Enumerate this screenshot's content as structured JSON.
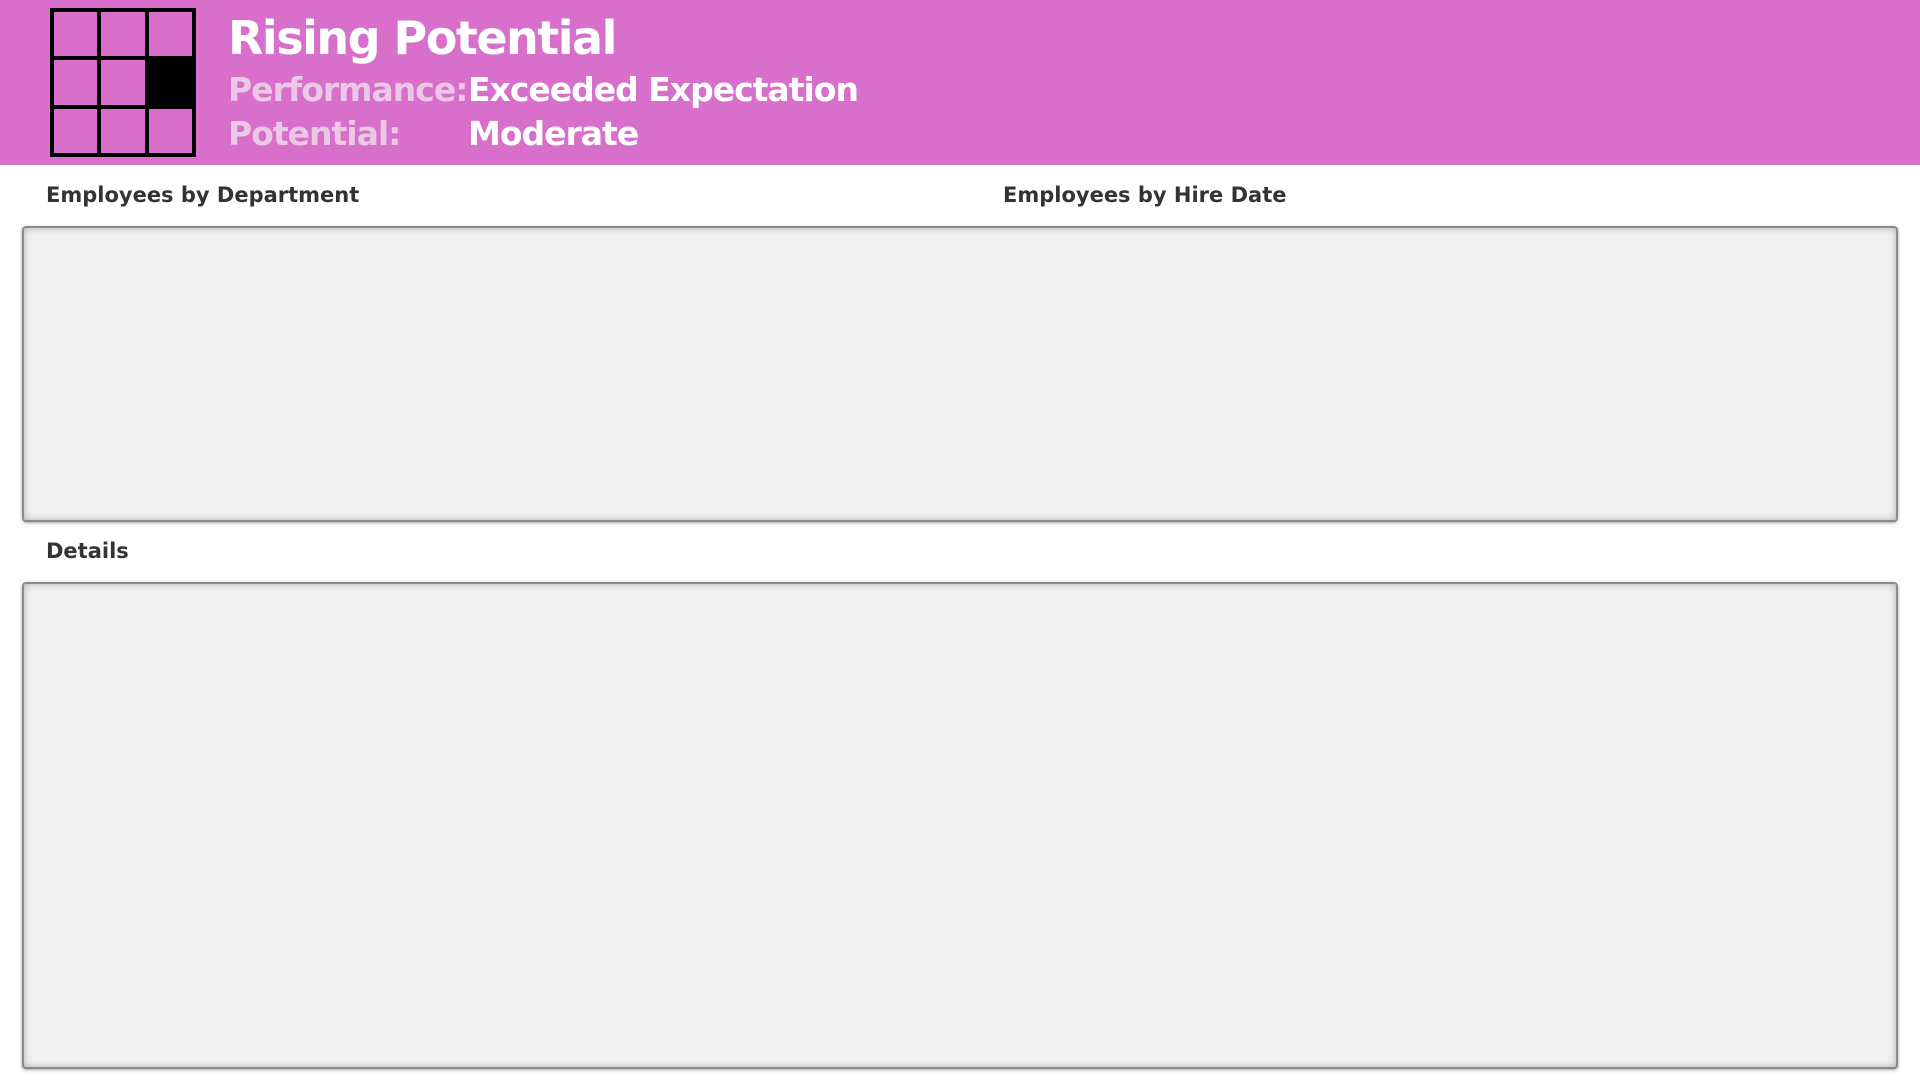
{
  "header": {
    "title": "Rising Potential",
    "performance_label": "Performance:",
    "performance_value": "Exceeded Expectation",
    "potential_label": "Potential:",
    "potential_value": "Moderate",
    "accent_color": "#D76FCB",
    "icon": "nine-box-grid-icon",
    "grid_highlight": {
      "row": 2,
      "column": 3
    }
  },
  "sections": {
    "department_label": "Employees by Department",
    "hire_date_label": "Employees by Hire Date",
    "details_label": "Details"
  }
}
